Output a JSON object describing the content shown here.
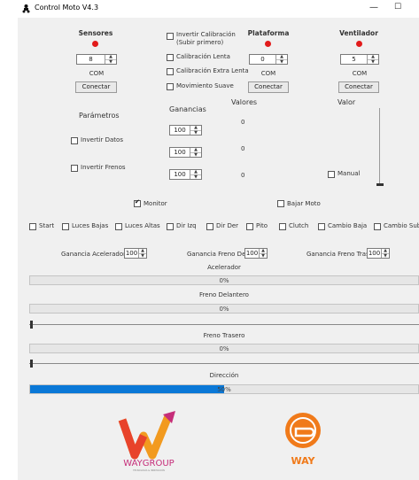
{
  "window": {
    "title": "Control Moto V4.3",
    "minimize_icon": "minimize-icon",
    "maximize_icon": "maximize-icon"
  },
  "sensores": {
    "title": "Sensores",
    "value": "8",
    "com_label": "COM",
    "connect_label": "Conectar",
    "status_color": "#e21b1b"
  },
  "plataforma": {
    "title": "Plataforma",
    "value": "0",
    "com_label": "COM",
    "connect_label": "Conectar",
    "status_color": "#e21b1b"
  },
  "ventilador": {
    "title": "Ventilador",
    "value": "5",
    "com_label": "COM",
    "connect_label": "Conectar",
    "status_color": "#e21b1b"
  },
  "options": {
    "invertir_calibracion": {
      "label": "Invertir Calibración",
      "sub": "(Subir primero)",
      "checked": false
    },
    "calibracion_lenta": {
      "label": "Calibración Lenta",
      "checked": false
    },
    "calibracion_extra_lenta": {
      "label": "Calibración Extra Lenta",
      "checked": false
    },
    "movimiento_suave": {
      "label": "Movimiento Suave",
      "checked": false
    }
  },
  "parametros": {
    "title": "Parámetros",
    "invertir_datos": "Invertir Datos",
    "invertir_frenos": "Invertir Frenos"
  },
  "ganancias": {
    "title": "Ganancias",
    "values": [
      "100",
      "100",
      "100"
    ]
  },
  "valores": {
    "title": "Valores",
    "values": [
      "0",
      "0",
      "0"
    ]
  },
  "valor": {
    "title": "Valor",
    "manual_label": "Manual"
  },
  "monitor": {
    "label": "Monitor",
    "checked": true
  },
  "bajar_moto": {
    "label": "Bajar Moto",
    "checked": false
  },
  "signals": [
    "Start",
    "Luces Bajas",
    "Luces Altas",
    "Dir Izq",
    "Dir Der",
    "Pito",
    "Clutch",
    "Cambio Baja",
    "Cambio Sube"
  ],
  "gains_row": {
    "acelerador": {
      "label": "Ganancia Acelerador",
      "value": "100"
    },
    "freno_del": {
      "label": "Ganancia Freno Del",
      "value": "100"
    },
    "freno_tras": {
      "label": "Ganancia Freno Tras",
      "value": "100"
    }
  },
  "acelerador": {
    "label": "Acelerador",
    "percent_text": "0%",
    "progress": 0
  },
  "freno_delantero": {
    "label": "Freno Delantero",
    "percent_text": "0%",
    "progress": 0
  },
  "freno_trasero": {
    "label": "Freno Trasero",
    "percent_text": "0%",
    "progress": 0
  },
  "direccion": {
    "label": "Dirección",
    "percent_text": "50%",
    "progress": 0.5
  },
  "logos": {
    "waygroup": {
      "name": "WAYGROUP",
      "tagline": "TECNOLOGÍA & INNOVACIÓN",
      "colors": [
        "#e8432b",
        "#f29a1f",
        "#c62e7a"
      ]
    },
    "way": {
      "name": "WAY",
      "colors": [
        "#f07a1a",
        "#ffffff"
      ]
    }
  },
  "colors": {
    "accent": "#0a78d7",
    "led": "#e21b1b"
  }
}
